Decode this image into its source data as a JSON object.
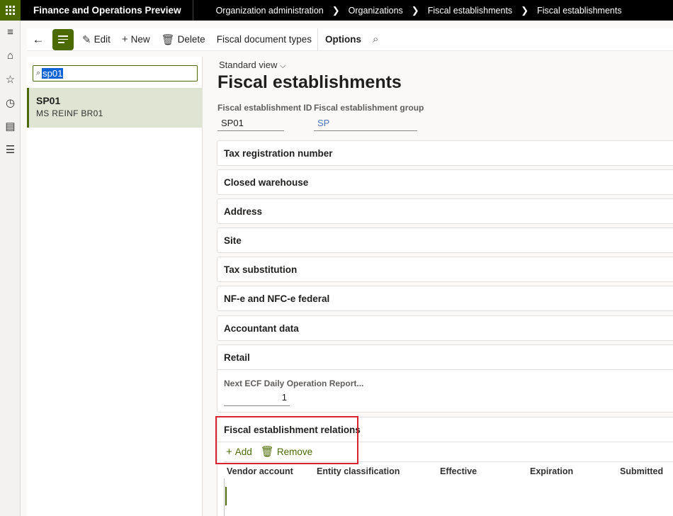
{
  "app": {
    "title": "Finance and Operations Preview"
  },
  "breadcrumb": [
    "Organization administration",
    "Organizations",
    "Fiscal establishments",
    "Fiscal establishments"
  ],
  "toolbar": {
    "edit_label": "Edit",
    "new_label": "New",
    "delete_label": "Delete",
    "fiscal_doc_label": "Fiscal document types",
    "options_label": "Options"
  },
  "list": {
    "filter_value": "sp01",
    "items": [
      {
        "title": "SP01",
        "subtitle": "MS REINF BR01"
      }
    ]
  },
  "header": {
    "view_label": "Standard view",
    "title": "Fiscal establishments"
  },
  "fields": {
    "id_label": "Fiscal establishment ID",
    "id_value": "SP01",
    "group_label": "Fiscal establishment group",
    "group_value": "SP"
  },
  "fasttabs": [
    "Tax registration number",
    "Closed warehouse",
    "Address",
    "Site",
    "Tax substitution",
    "NF-e and NFC-e federal",
    "Accountant data"
  ],
  "retail": {
    "title": "Retail",
    "field_label": "Next ECF Daily Operation Report...",
    "field_value": "1"
  },
  "relations": {
    "title": "Fiscal establishment relations",
    "add_label": "Add",
    "remove_label": "Remove",
    "columns": [
      "Vendor account",
      "Entity classification",
      "Effective",
      "Expiration",
      "Submitted"
    ]
  },
  "colors": {
    "accent": "#4b6a00",
    "highlight": "#d9232e",
    "topbar": "#000000"
  }
}
